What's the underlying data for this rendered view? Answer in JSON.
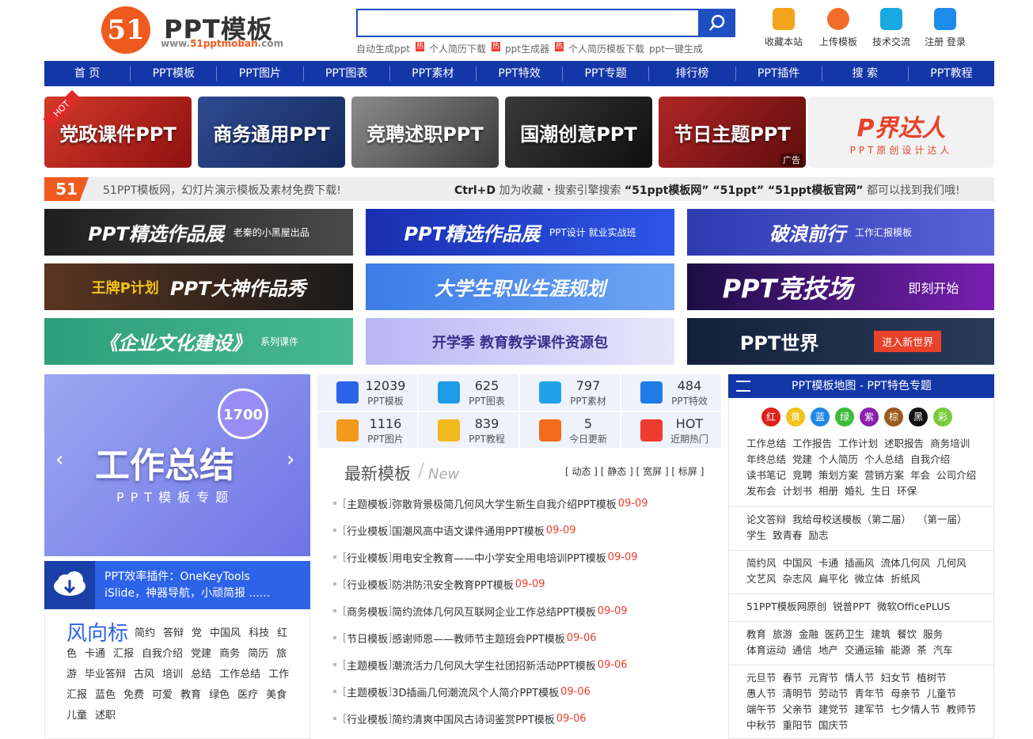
{
  "header": {
    "logo_badge": "51",
    "logo_title": "PPT模板",
    "logo_url_prefix": "www.",
    "logo_url_brand": "51pptmoban",
    "logo_url_suffix": ".com",
    "search_value": "",
    "hot_links": [
      {
        "text": "自动生成ppt",
        "hot": "热"
      },
      {
        "text": "个人简历下载",
        "hot": "热"
      },
      {
        "text": "ppt生成器",
        "hot": "热"
      },
      {
        "text": "个人简历模板下载",
        "hot": ""
      },
      {
        "text": "ppt一键生成",
        "hot": ""
      }
    ],
    "top_icons": [
      {
        "label": "收藏本站",
        "icon": "bookmark-icon",
        "color": "#f3a31c"
      },
      {
        "label": "上传模板",
        "icon": "upload-icon",
        "color": "#f26c2a"
      },
      {
        "label": "技术交流",
        "icon": "chat-icon",
        "color": "#17a9e0"
      },
      {
        "label": "注册 登录",
        "icon": "user-icon",
        "color": "#1e8be8"
      }
    ]
  },
  "nav": [
    "首 页",
    "PPT模板",
    "PPT图片",
    "PPT图表",
    "PPT素材",
    "PPT特效",
    "PPT专题",
    "排行榜",
    "PPT插件",
    "搜 索",
    "PPT教程"
  ],
  "categories": [
    {
      "label": "党政课件PPT",
      "color": "#b51d1d"
    },
    {
      "label": "商务通用PPT",
      "color": "#203a78"
    },
    {
      "label": "竞聘述职PPT",
      "color": "#5d5d5d"
    },
    {
      "label": "国潮创意PPT",
      "color": "#1c1c1c"
    },
    {
      "label": "节日主题PPT",
      "color": "#8a1717"
    },
    {
      "label": "P界达人",
      "sub": "PPT原创设计达人",
      "color": "#f2f2f2"
    }
  ],
  "hot_ribbon": "HOT",
  "ad_tag": "广告",
  "notice": {
    "logo": "51",
    "left": "51PPT模板网，幻灯片演示模板及素材免费下载!",
    "right_a": "Ctrl+D",
    "right_b": " 加为收藏・搜索引擎搜索 ",
    "right_c": "“51ppt模板网” “51ppt” “51ppt模板官网”",
    "right_d": " 都可以找到我们哦!"
  },
  "promos": [
    {
      "title": "PPT精选作品展",
      "sub": "老秦的小黑屋出品",
      "color": "#2b2b2b"
    },
    {
      "title": "PPT精选作品展",
      "sub": "PPT设计 就业实战班",
      "color": "#1a2fb0"
    },
    {
      "title": "破浪前行",
      "sub": "工作汇报模板",
      "color": "#3f49c9"
    },
    {
      "title": "PPT大神作品秀",
      "sub": "王牌P计划",
      "color": "#3a2418"
    },
    {
      "title": "大学生职业生涯规划",
      "sub": "",
      "color": "#3b7ce8"
    },
    {
      "title": "PPT竞技场",
      "sub": "即刻开始",
      "color": "#2a1760"
    },
    {
      "title": "《企业文化建设》",
      "sub": "系列课件",
      "color": "#2f9e7a"
    },
    {
      "title": "开学季 教育教学课件资源包",
      "sub": "",
      "color": "#c9c6f5"
    },
    {
      "title": "PPT世界",
      "sub": "进入新世界",
      "color": "#13213a"
    }
  ],
  "feature": {
    "badge": "1700",
    "title": "工作总结",
    "subtitle": "PPT模板专题",
    "prev": "‹",
    "next": "›"
  },
  "plugin": {
    "line1": "PPT效率插件：OneKeyTools",
    "line2": "iSlide，神器导航，小顽简报 ......"
  },
  "vane": {
    "title": "风向标",
    "tags": [
      "简约",
      "答辩",
      "党",
      "中国风",
      "科技",
      "红色",
      "卡通",
      "汇报",
      "自我介绍",
      "党建",
      "商务",
      "简历",
      "旅游",
      "毕业答辩",
      "古风",
      "培训",
      "总结",
      "工作总结",
      "工作汇报",
      "蓝色",
      "免费",
      "可爱",
      "教育",
      "绿色",
      "医疗",
      "美食",
      "儿童",
      "述职"
    ]
  },
  "stats": [
    {
      "num": "12039",
      "label": "PPT模板",
      "icon": "ppt-icon",
      "color": "#2d63e8"
    },
    {
      "num": "625",
      "label": "PPT图表",
      "icon": "pie-chart-icon",
      "color": "#1f9be8"
    },
    {
      "num": "797",
      "label": "PPT素材",
      "icon": "material-icon",
      "color": "#1fa3e8"
    },
    {
      "num": "484",
      "label": "PPT特效",
      "icon": "effect-icon",
      "color": "#1f7be8"
    },
    {
      "num": "1116",
      "label": "PPT图片",
      "icon": "image-icon",
      "color": "#f29a1c"
    },
    {
      "num": "839",
      "label": "PPT教程",
      "icon": "tutorial-icon",
      "color": "#f2b81c"
    },
    {
      "num": "5",
      "label": "今日更新",
      "icon": "refresh-icon",
      "color": "#f26c1c"
    },
    {
      "num": "HOT",
      "label": "近期热门",
      "icon": "hot-icon",
      "color": "#ef3b2e"
    }
  ],
  "latest": {
    "title": "最新模板",
    "new_label": "New",
    "filters": "[ 动态 ] [ 静态 ] [ 宽屏 ] [ 标屏 ]",
    "items": [
      {
        "cat": "主题模板",
        "title": "弥散背景极简几何风大学生新生自我介绍PPT模板",
        "date": "09-09"
      },
      {
        "cat": "行业模板",
        "title": "国潮风高中语文课件通用PPT模板",
        "date": "09-09"
      },
      {
        "cat": "行业模板",
        "title": "用电安全教育——中小学安全用电培训PPT模板",
        "date": "09-09"
      },
      {
        "cat": "行业模板",
        "title": "防洪防汛安全教育PPT模板",
        "date": "09-09"
      },
      {
        "cat": "商务模板",
        "title": "简约流体几何风互联网企业工作总结PPT模板",
        "date": "09-09"
      },
      {
        "cat": "节日模板",
        "title": "感谢师恩——教师节主题班会PPT模板",
        "date": "09-06"
      },
      {
        "cat": "主题模板",
        "title": "潮流活力几何风大学生社团招新活动PPT模板",
        "date": "09-06"
      },
      {
        "cat": "主题模板",
        "title": "3D插画几何潮流风个人简介PPT模板",
        "date": "09-06"
      },
      {
        "cat": "行业模板",
        "title": "简约清爽中国风古诗词鉴赏PPT模板",
        "date": "09-06"
      }
    ]
  },
  "map": {
    "title": "PPT模板地图 - PPT特色专题",
    "colors": [
      {
        "label": "红",
        "color": "#e0221a"
      },
      {
        "label": "黄",
        "color": "#f2c318"
      },
      {
        "label": "蓝",
        "color": "#1f87e8"
      },
      {
        "label": "绿",
        "color": "#3dba3a"
      },
      {
        "label": "紫",
        "color": "#8a1fb0"
      },
      {
        "label": "棕",
        "color": "#9b5a1e"
      },
      {
        "label": "黑",
        "color": "#111111"
      },
      {
        "label": "彩",
        "color": "#7acb3c"
      }
    ],
    "groups": [
      [
        "工作总结",
        "工作报告",
        "工作计划",
        "述职报告",
        "商务培训",
        "年终总结",
        "党建",
        "个人简历",
        "个人总结",
        "自我介绍",
        "读书笔记",
        "竞聘",
        "策划方案",
        "营销方案",
        "年会",
        "公司介绍",
        "发布会",
        "计划书",
        "相册",
        "婚礼",
        "生日",
        "环保"
      ],
      [
        "论文答辩",
        "我给母校送模板（第二届）",
        "（第一届）",
        "学生",
        "致青春",
        "励志"
      ],
      [
        "简约风",
        "中国风",
        "卡通",
        "插画风",
        "流体几何风",
        "几何风",
        "文艺风",
        "杂志风",
        "扁平化",
        "微立体",
        "折纸风"
      ],
      [
        "51PPT模板网原创",
        "锐普PPT",
        "微软OfficePLUS"
      ],
      [
        "教育",
        "旅游",
        "金融",
        "医药卫生",
        "建筑",
        "餐饮",
        "服务",
        "体育运动",
        "通信",
        "地产",
        "交通运输",
        "能源",
        "茶",
        "汽车"
      ],
      [
        "元旦节",
        "春节",
        "元宵节",
        "情人节",
        "妇女节",
        "植树节",
        "愚人节",
        "清明节",
        "劳动节",
        "青年节",
        "母亲节",
        "儿童节",
        "端午节",
        "父亲节",
        "建党节",
        "建军节",
        "七夕情人节",
        "教师节",
        "中秋节",
        "重阳节",
        "国庆节"
      ]
    ]
  }
}
